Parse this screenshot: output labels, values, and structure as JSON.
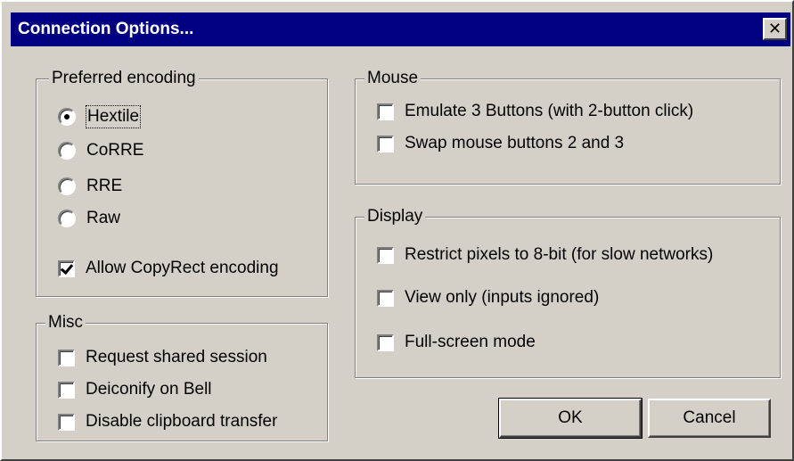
{
  "window": {
    "title": "Connection Options...",
    "close_glyph": "✕"
  },
  "encoding": {
    "title": "Preferred encoding",
    "options": [
      {
        "label": "Hextile",
        "selected": true
      },
      {
        "label": "CoRRE",
        "selected": false
      },
      {
        "label": "RRE",
        "selected": false
      },
      {
        "label": "Raw",
        "selected": false
      }
    ],
    "copyrect": {
      "label": "Allow CopyRect encoding",
      "checked": true
    }
  },
  "misc": {
    "title": "Misc",
    "options": [
      {
        "label": "Request shared session",
        "checked": false
      },
      {
        "label": "Deiconify on Bell",
        "checked": false
      },
      {
        "label": "Disable clipboard transfer",
        "checked": false
      }
    ]
  },
  "mouse": {
    "title": "Mouse",
    "options": [
      {
        "label": "Emulate 3 Buttons (with 2-button click)",
        "checked": false
      },
      {
        "label": "Swap mouse buttons 2 and 3",
        "checked": false
      }
    ]
  },
  "display": {
    "title": "Display",
    "options": [
      {
        "label": "Restrict pixels to 8-bit (for slow networks)",
        "checked": false
      },
      {
        "label": "View only (inputs ignored)",
        "checked": false
      },
      {
        "label": "Full-screen mode",
        "checked": false
      }
    ]
  },
  "buttons": {
    "ok": "OK",
    "cancel": "Cancel"
  },
  "colors": {
    "titlebar": "#000080",
    "face": "#d4d0c8"
  }
}
